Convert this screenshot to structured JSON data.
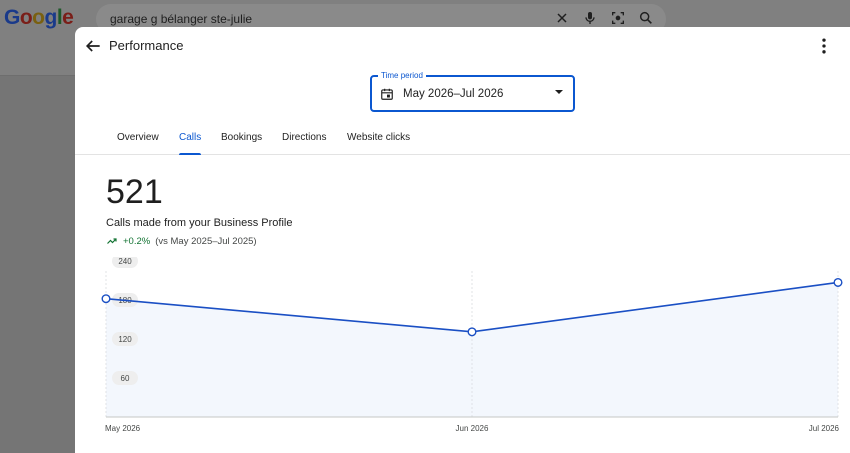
{
  "background": {
    "logo_letters": [
      {
        "ch": "G",
        "color": "#1a3a8a"
      },
      {
        "ch": "o",
        "color": "#7a1e18"
      },
      {
        "ch": "o",
        "color": "#7a6010"
      },
      {
        "ch": "g",
        "color": "#1a3a8a"
      },
      {
        "ch": "l",
        "color": "#1e5a2a"
      },
      {
        "ch": "e",
        "color": "#7a1e18"
      }
    ],
    "search_query": "garage g bélanger ste-julie",
    "search_icons": [
      "close-icon",
      "microphone-icon",
      "lens-icon",
      "search-icon"
    ]
  },
  "modal": {
    "title": "Performance",
    "back_icon": "arrow-back-icon",
    "menu_icon": "more-vert-icon",
    "time_period": {
      "label": "Time period",
      "value": "May 2026–Jul 2026",
      "icon": "calendar-icon"
    },
    "tabs": [
      {
        "label": "Overview",
        "active": false
      },
      {
        "label": "Calls",
        "active": true
      },
      {
        "label": "Bookings",
        "active": false
      },
      {
        "label": "Directions",
        "active": false
      },
      {
        "label": "Website clicks",
        "active": false
      }
    ],
    "metric": {
      "value": "521",
      "label": "Calls made from your Business Profile",
      "change": "+0.2%",
      "comparison": "(vs May 2025–Jul 2025)",
      "trend_icon": "trending-up-icon"
    },
    "colors": {
      "accent": "#0b57d0",
      "line": "#1a4fc4",
      "positive": "#137333"
    }
  },
  "chart_data": {
    "type": "line",
    "categories": [
      "May 2026",
      "Jun 2026",
      "Jul 2026"
    ],
    "values": [
      182,
      131,
      207
    ],
    "yticks": [
      "240",
      "180",
      "120",
      "60"
    ],
    "ylim": [
      0,
      240
    ],
    "grid": true
  }
}
